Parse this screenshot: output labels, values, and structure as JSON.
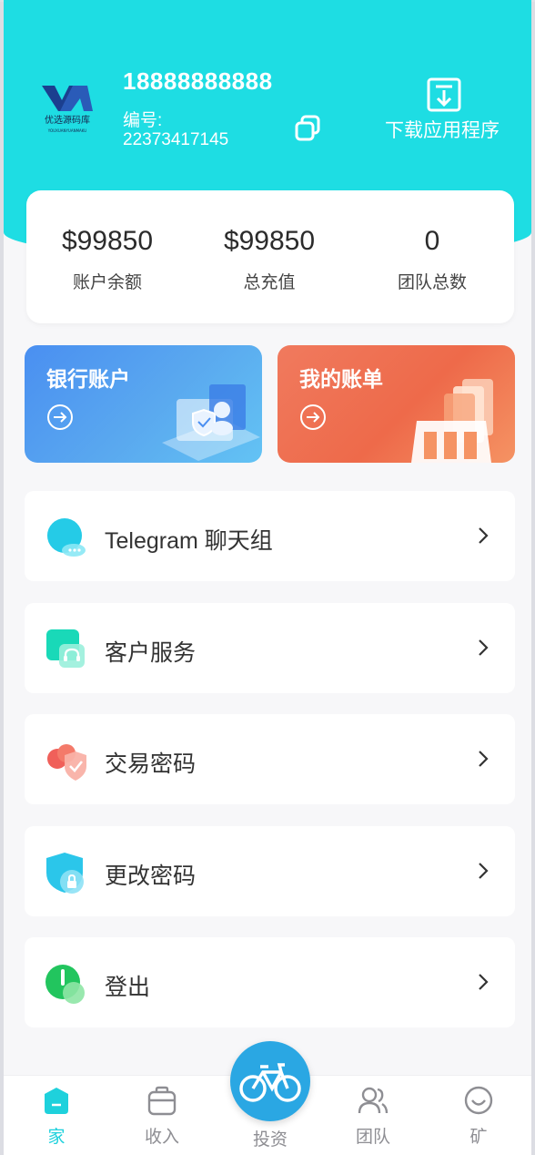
{
  "header": {
    "logo_text": "优选源码库",
    "logo_sub": "YOUXUANYUANMAKU",
    "phone": "18888888888",
    "uid_label": "编号:",
    "uid_value": "22373417145",
    "download_label": "下载应用程序"
  },
  "stats": [
    {
      "value": "$99850",
      "label": "账户余额"
    },
    {
      "value": "$99850",
      "label": "总充值"
    },
    {
      "value": "0",
      "label": "团队总数"
    }
  ],
  "cards": {
    "bank": {
      "title": "银行账户"
    },
    "bill": {
      "title": "我的账单"
    }
  },
  "menu": [
    {
      "label": "Telegram 聊天组",
      "icon": "chat-icon"
    },
    {
      "label": "客户服务",
      "icon": "headset-icon"
    },
    {
      "label": "交易密码",
      "icon": "shield-check-icon"
    },
    {
      "label": "更改密码",
      "icon": "lock-shield-icon"
    },
    {
      "label": "登出",
      "icon": "power-icon"
    }
  ],
  "tabbar": {
    "home": "家",
    "income": "收入",
    "invest": "投资",
    "team": "团队",
    "mine": "矿"
  },
  "colors": {
    "accent": "#1edde3",
    "tab_active": "#1ed1dc",
    "bank_card": "#4a8ff1",
    "bill_card": "#ee6a4a",
    "center_button": "#2aa7e3"
  }
}
